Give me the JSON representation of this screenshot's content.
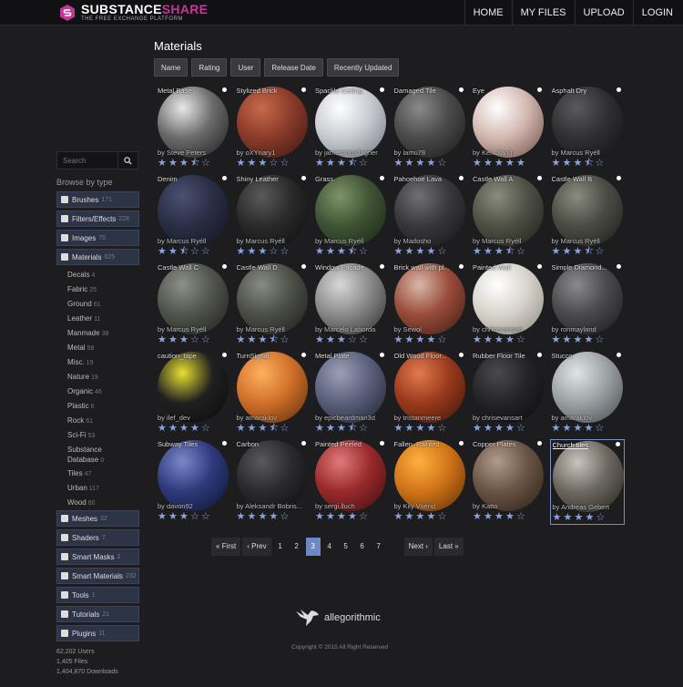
{
  "logo": {
    "title_main": "SUBSTANCE",
    "title_accent": "SHARE",
    "subtitle": "THE FREE EXCHANGE PLATFORM"
  },
  "nav": [
    "HOME",
    "MY FILES",
    "UPLOAD",
    "LOGIN"
  ],
  "sidebar": {
    "search_placeholder": "Search",
    "browse_label": "Browse by type",
    "before": [
      {
        "label": "Brushes",
        "count": "171"
      },
      {
        "label": "Filters/Effects",
        "count": "228"
      },
      {
        "label": "Images",
        "count": "75"
      },
      {
        "label": "Materials",
        "count": "625"
      }
    ],
    "subcategories": [
      {
        "label": "Decals",
        "count": "4"
      },
      {
        "label": "Fabric",
        "count": "25"
      },
      {
        "label": "Ground",
        "count": "61"
      },
      {
        "label": "Leather",
        "count": "11"
      },
      {
        "label": "Manmade",
        "count": "38"
      },
      {
        "label": "Metal",
        "count": "58"
      },
      {
        "label": "Misc.",
        "count": "19"
      },
      {
        "label": "Nature",
        "count": "19"
      },
      {
        "label": "Organic",
        "count": "46"
      },
      {
        "label": "Plastic",
        "count": "6"
      },
      {
        "label": "Rock",
        "count": "61"
      },
      {
        "label": "Sci-Fi",
        "count": "53"
      },
      {
        "label": "Substance Database",
        "count": "0"
      },
      {
        "label": "Tiles",
        "count": "47"
      },
      {
        "label": "Urban",
        "count": "117"
      },
      {
        "label": "Wood",
        "count": "60"
      }
    ],
    "after": [
      {
        "label": "Meshes",
        "count": "32"
      },
      {
        "label": "Shaders",
        "count": "7"
      },
      {
        "label": "Smart Masks",
        "count": "2"
      },
      {
        "label": "Smart Materials",
        "count": "232"
      },
      {
        "label": "Tools",
        "count": "1"
      },
      {
        "label": "Tutorials",
        "count": "21"
      },
      {
        "label": "Plugins",
        "count": "11"
      }
    ],
    "stats": [
      "62,202 Users",
      "1,405 Files",
      "1,404,870 Downloads"
    ]
  },
  "main": {
    "title": "Materials",
    "sort_buttons": [
      "Name",
      "Rating",
      "User",
      "Release Date",
      "Recently Updated"
    ]
  },
  "materials": [
    {
      "name": "Metal Base",
      "author": "by Steve Peters",
      "rating": 3.5,
      "colors": [
        "#e8e8e8",
        "#6b6b6b",
        "#1a1a1a"
      ]
    },
    {
      "name": "Stylized Brick",
      "author": "by oXYnary1",
      "rating": 3,
      "colors": [
        "#c86a4c",
        "#8a3b2a",
        "#3a160f"
      ]
    },
    {
      "name": "Spackle Ceiling",
      "author": "by jamesjmgallagher",
      "rating": 3.5,
      "colors": [
        "#ffffff",
        "#c8ccd2",
        "#6f747c"
      ]
    },
    {
      "name": "Damaged Tile",
      "author": "by lamu78",
      "rating": 4,
      "colors": [
        "#8a8a8a",
        "#4a4a4a",
        "#181818"
      ]
    },
    {
      "name": "Eye",
      "author": "by Ken Jiang",
      "rating": 5,
      "colors": [
        "#ffffff",
        "#d2b8b0",
        "#6a4a40"
      ]
    },
    {
      "name": "Asphalt Dry",
      "author": "by Marcus Ryéll",
      "rating": 3.5,
      "colors": [
        "#5a5a5c",
        "#303032",
        "#121214"
      ]
    },
    {
      "name": "Denim",
      "author": "by Marcus Ryéll",
      "rating": 2.5,
      "colors": [
        "#4a5070",
        "#2a2e44",
        "#111320"
      ]
    },
    {
      "name": "Shiny Leather",
      "author": "by Marcus Ryéll",
      "rating": 3,
      "colors": [
        "#5a5a5a",
        "#2a2a2a",
        "#0c0c0c"
      ]
    },
    {
      "name": "Grass",
      "author": "by Marcus Ryéll",
      "rating": 3.5,
      "colors": [
        "#7c9468",
        "#3f5334",
        "#172214"
      ]
    },
    {
      "name": "Pahoehoe Lava",
      "author": "by Madosho",
      "rating": 4,
      "colors": [
        "#707074",
        "#38383c",
        "#141416"
      ]
    },
    {
      "name": "Castle Wall A",
      "author": "by Marcus Ryéll",
      "rating": 3.5,
      "colors": [
        "#8a8c7c",
        "#4d5044",
        "#1c1d18"
      ]
    },
    {
      "name": "Castle Wall B",
      "author": "by Marcus Ryéll",
      "rating": 3.5,
      "colors": [
        "#8a8c80",
        "#4a4c44",
        "#1a1b18"
      ]
    },
    {
      "name": "Castle Wall C",
      "author": "by Marcus Ryéll",
      "rating": 3,
      "colors": [
        "#8c9088",
        "#50544c",
        "#1c1e1a"
      ]
    },
    {
      "name": "Castle Wall D",
      "author": "by Marcus Ryéll",
      "rating": 3.5,
      "colors": [
        "#888a84",
        "#4c4e48",
        "#1a1b19"
      ]
    },
    {
      "name": "Window Facade",
      "author": "by Marcelo Laborda",
      "rating": 3,
      "colors": [
        "#d8d8d8",
        "#8a8a8a",
        "#2a2a2a"
      ]
    },
    {
      "name": "Brick wall with pl...",
      "author": "by Sewol",
      "rating": 4,
      "colors": [
        "#d8b8a8",
        "#9a4c3a",
        "#3a1a12"
      ]
    },
    {
      "name": "Painted Wall",
      "author": "by chrisevansart",
      "rating": 4,
      "colors": [
        "#ffffff",
        "#d8d4cc",
        "#8a867e"
      ]
    },
    {
      "name": "Simple Diamond...",
      "author": "by ronmayland",
      "rating": 4,
      "colors": [
        "#8a8a8c",
        "#4a4a4c",
        "#18181a"
      ]
    },
    {
      "name": "caution_tape",
      "author": "by ilef_dev",
      "rating": 4,
      "colors": [
        "#e8e030",
        "#202020",
        "#0a0a0a"
      ]
    },
    {
      "name": "TurnSignal",
      "author": "by amaraklov",
      "rating": 3.5,
      "colors": [
        "#ffb060",
        "#d0702a",
        "#5a2a08"
      ]
    },
    {
      "name": "Metal Plate",
      "author": "by epicbeardman3d",
      "rating": 3.5,
      "colors": [
        "#9aa0b4",
        "#5a607a",
        "#1e2030"
      ]
    },
    {
      "name": "Old Wood Floor...",
      "author": "by tristanmeere",
      "rating": 4,
      "colors": [
        "#e07a50",
        "#9a3a1c",
        "#3a140a"
      ]
    },
    {
      "name": "Rubber Floor Tile",
      "author": "by chrisevansart",
      "rating": 4,
      "colors": [
        "#4a4a4c",
        "#242426",
        "#0a0a0c"
      ]
    },
    {
      "name": "Stucco",
      "author": "by amaraklov",
      "rating": 4,
      "colors": [
        "#e0e4e4",
        "#9ca2a4",
        "#40464a"
      ]
    },
    {
      "name": "Subway Tiles",
      "author": "by davon92",
      "rating": 3,
      "colors": [
        "#7a88c8",
        "#2e3a7c",
        "#0c1230"
      ]
    },
    {
      "name": "Carbon",
      "author": "by Aleksandr Bobris...",
      "rating": 4,
      "colors": [
        "#5a5a5c",
        "#2a2a2c",
        "#0c0c0e"
      ]
    },
    {
      "name": "Painted Peeled",
      "author": "by sergi.lluch",
      "rating": 4,
      "colors": [
        "#e07a7a",
        "#9a2a2c",
        "#3a0c0e"
      ]
    },
    {
      "name": "Fallen_Painted",
      "author": "by Kily Vriend",
      "rating": 4,
      "colors": [
        "#ffb040",
        "#d07418",
        "#5a2c06"
      ]
    },
    {
      "name": "Copper Plates",
      "author": "by Katto",
      "rating": 4,
      "colors": [
        "#b09a88",
        "#6a5446",
        "#2a1c14"
      ]
    },
    {
      "name": "Church tiles",
      "author": "by Andreas Gebert",
      "rating": 4,
      "colors": [
        "#c8c4bc",
        "#6c6860",
        "#22201c"
      ],
      "selected": true
    }
  ],
  "pagination": {
    "first": "« First",
    "prev": "‹ Prev",
    "pages": [
      "1",
      "2",
      "3",
      "4",
      "5",
      "6",
      "7"
    ],
    "active": "3",
    "next": "Next ›",
    "last": "Last »"
  },
  "footer": {
    "brand": "allegorithmic",
    "copyright": "Copyright © 2015 All Right Reserved"
  },
  "colors": {
    "accent": "#6e88c4",
    "brand_pink": "#c0399a",
    "category_bg": "#2c3446"
  }
}
